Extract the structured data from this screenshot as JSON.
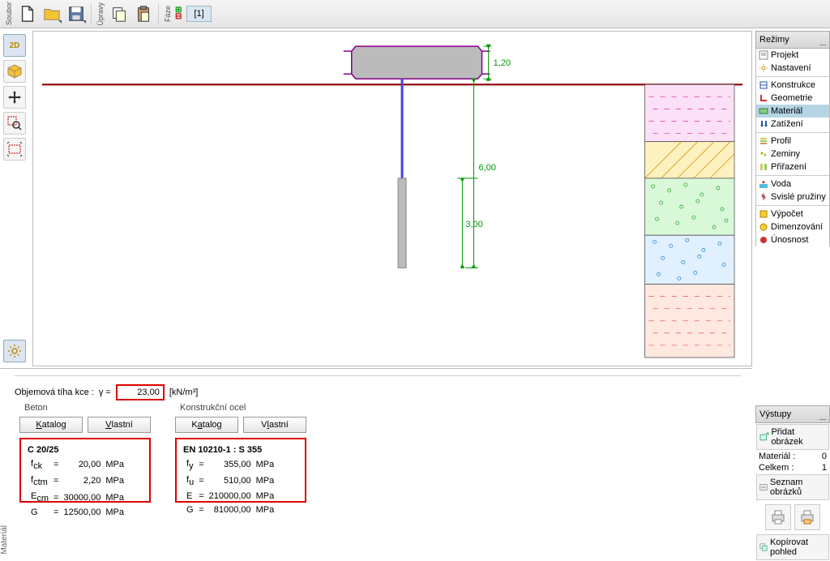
{
  "toolbar_labels": {
    "soubor": "Soubor",
    "upravy": "Úpravy",
    "faze": "Fáze",
    "phase_tab": "[1]"
  },
  "modes": {
    "header": "Režimy",
    "items": [
      {
        "label": "Projekt"
      },
      {
        "label": "Nastavení"
      },
      {
        "label": "Konstrukce"
      },
      {
        "label": "Geometrie"
      },
      {
        "label": "Materiál"
      },
      {
        "label": "Zatížení"
      },
      {
        "label": "Profil"
      },
      {
        "label": "Zeminy"
      },
      {
        "label": "Přiřazení"
      },
      {
        "label": "Voda"
      },
      {
        "label": "Svislé pružiny"
      },
      {
        "label": "Výpočet"
      },
      {
        "label": "Dimenzování"
      },
      {
        "label": "Únosnost"
      }
    ]
  },
  "outputs": {
    "header": "Výstupy",
    "add_image": "Přidat obrázek",
    "material_label": "Materiál :",
    "material_count": "0",
    "total_label": "Celkem :",
    "total_count": "1",
    "image_list": "Seznam obrázků",
    "copy_view": "Kopírovat pohled"
  },
  "material": {
    "weight_label": "Objemová tíha kce :",
    "gamma": "γ =",
    "weight_value": "23,00",
    "weight_unit": "[kN/m³]",
    "beton_legend": "Beton",
    "steel_legend": "Konstrukční ocel",
    "katalog": "Katalog",
    "vlastni": "Vlastní",
    "concrete": {
      "name": "C 20/25",
      "fck": "20,00",
      "fctm": "2,20",
      "ecm": "30000,00",
      "g": "12500,00",
      "unit": "MPa"
    },
    "steel": {
      "name": "EN 10210-1 : S 355",
      "fy": "355,00",
      "fu": "510,00",
      "e": "210000,00",
      "g": "81000,00",
      "unit": "MPa"
    }
  },
  "dims": {
    "d1": "1,20",
    "d2": "6,00",
    "d3": "3,00"
  }
}
